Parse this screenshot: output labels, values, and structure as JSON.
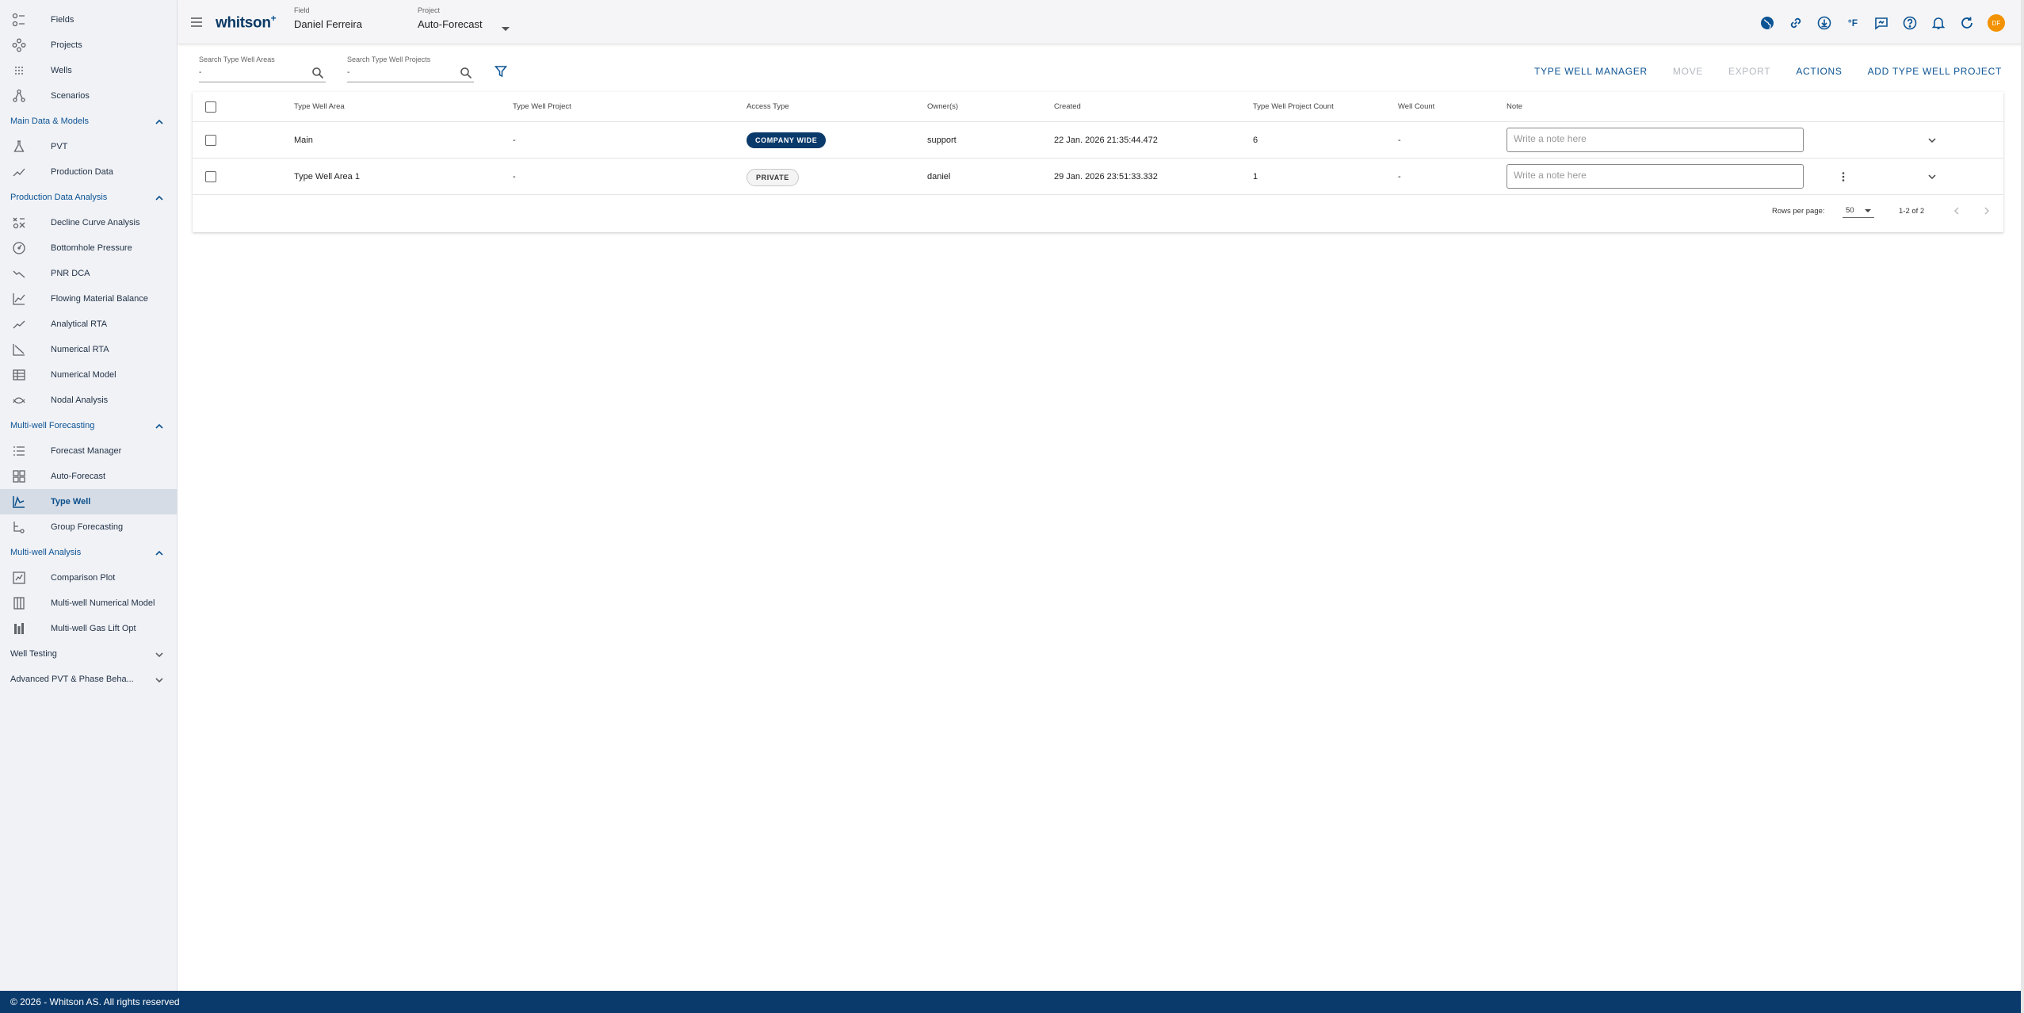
{
  "sidebar": {
    "top_items": [
      {
        "label": "Fields",
        "icon": "fields-icon"
      },
      {
        "label": "Projects",
        "icon": "projects-icon"
      },
      {
        "label": "Wells",
        "icon": "wells-icon"
      },
      {
        "label": "Scenarios",
        "icon": "scenarios-icon"
      }
    ],
    "sections": [
      {
        "title": "Main Data & Models",
        "expanded": true,
        "items": [
          {
            "label": "PVT",
            "icon": "flask-icon"
          },
          {
            "label": "Production Data",
            "icon": "trend-icon"
          }
        ]
      },
      {
        "title": "Production Data Analysis",
        "expanded": true,
        "items": [
          {
            "label": "Decline Curve Analysis",
            "icon": "dca-icon"
          },
          {
            "label": "Bottomhole Pressure",
            "icon": "gauge-icon"
          },
          {
            "label": "PNR DCA",
            "icon": "decline-icon"
          },
          {
            "label": "Flowing Material Balance",
            "icon": "fmb-icon"
          },
          {
            "label": "Analytical RTA",
            "icon": "rta-icon"
          },
          {
            "label": "Numerical RTA",
            "icon": "numerical-rta-icon"
          },
          {
            "label": "Numerical Model",
            "icon": "model-icon"
          },
          {
            "label": "Nodal Analysis",
            "icon": "nodal-icon"
          }
        ]
      },
      {
        "title": "Multi-well Forecasting",
        "expanded": true,
        "items": [
          {
            "label": "Forecast Manager",
            "icon": "list-icon"
          },
          {
            "label": "Auto-Forecast",
            "icon": "grid-icon"
          },
          {
            "label": "Type Well",
            "icon": "type-well-icon",
            "active": true
          },
          {
            "label": "Group Forecasting",
            "icon": "group-icon"
          }
        ]
      },
      {
        "title": "Multi-well Analysis",
        "expanded": true,
        "items": [
          {
            "label": "Comparison Plot",
            "icon": "comparison-icon"
          },
          {
            "label": "Multi-well Numerical Model",
            "icon": "multi-model-icon"
          },
          {
            "label": "Multi-well Gas Lift Opt",
            "icon": "gas-lift-icon"
          }
        ]
      },
      {
        "title": "Well Testing",
        "expanded": false,
        "items": []
      },
      {
        "title": "Advanced PVT & Phase Beha...",
        "expanded": false,
        "items": []
      }
    ]
  },
  "topbar": {
    "logo": "whitson",
    "logo_sup": "+",
    "field_caption": "Field",
    "field_value": "Daniel Ferreira",
    "project_caption": "Project",
    "project_value": "Auto-Forecast",
    "temp_unit": "°F",
    "avatar_initials": "DF"
  },
  "toolbar": {
    "search_areas_label": "Search Type Well Areas",
    "search_areas_value": "-",
    "search_projects_label": "Search Type Well Projects",
    "search_projects_value": "-",
    "buttons": {
      "manager": "TYPE WELL MANAGER",
      "move": "MOVE",
      "export": "EXPORT",
      "actions": "ACTIONS",
      "add": "ADD TYPE WELL PROJECT"
    }
  },
  "table": {
    "headers": {
      "area": "Type Well Area",
      "project": "Type Well Project",
      "access": "Access Type",
      "owner": "Owner(s)",
      "created": "Created",
      "project_count": "Type Well Project Count",
      "well_count": "Well Count",
      "note": "Note"
    },
    "rows": [
      {
        "area": "Main",
        "project": "-",
        "access": "COMPANY WIDE",
        "owner": "support",
        "created": "22 Jan. 2026 21:35:44.472",
        "project_count": "6",
        "well_count": "-",
        "note_placeholder": "Write a note here"
      },
      {
        "area": "Type Well Area 1",
        "project": "-",
        "access": "PRIVATE",
        "owner": "daniel",
        "created": "29 Jan. 2026 23:51:33.332",
        "project_count": "1",
        "well_count": "-",
        "note_placeholder": "Write a note here"
      }
    ],
    "pagination": {
      "rows_per_page_label": "Rows per page:",
      "rows_per_page": "50",
      "range": "1-2 of 2"
    }
  },
  "footer": {
    "text": "© 2026 - Whitson AS. All rights reserved"
  },
  "colors": {
    "brand": "#0a3a6b",
    "accent": "#0b5394",
    "avatar": "#f39200"
  }
}
